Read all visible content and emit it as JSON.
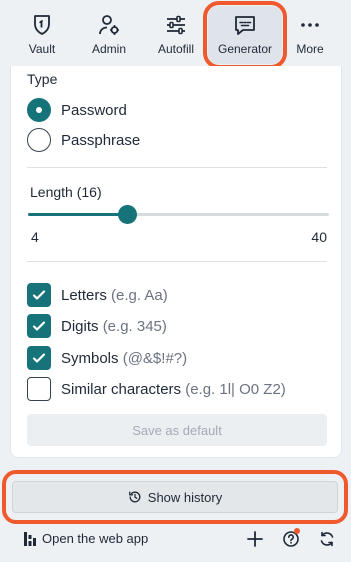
{
  "nav": {
    "vault": "Vault",
    "admin": "Admin",
    "autofill": "Autofill",
    "generator": "Generator",
    "more": "More"
  },
  "generator": {
    "type_title": "Type",
    "type_options": [
      {
        "label": "Password",
        "selected": true
      },
      {
        "label": "Passphrase",
        "selected": false
      }
    ],
    "length_label": "Length (16)",
    "length_value": 16,
    "length_min": "4",
    "length_max": "40",
    "options": [
      {
        "label": "Letters",
        "hint": "(e.g. Aa)",
        "checked": true
      },
      {
        "label": "Digits",
        "hint": "(e.g. 345)",
        "checked": true
      },
      {
        "label": "Symbols",
        "hint": "(@&$!#?)",
        "checked": true
      },
      {
        "label": "Similar characters",
        "hint": "(e.g. 1l| O0 Z2)",
        "checked": false
      }
    ],
    "save_default_label": "Save as default"
  },
  "history_button_label": "Show history",
  "footer": {
    "web_app_label": "Open the web app"
  },
  "colors": {
    "accent": "#17737a",
    "highlight": "#f0592e"
  }
}
